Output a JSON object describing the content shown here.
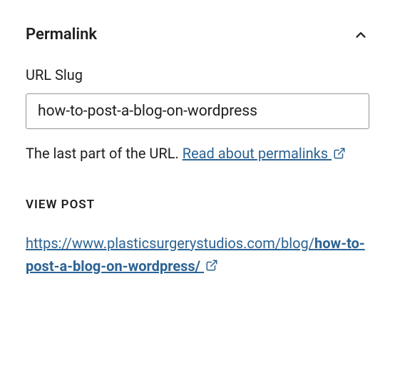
{
  "panel": {
    "title": "Permalink"
  },
  "slug": {
    "label": "URL Slug",
    "value": "how-to-post-a-blog-on-wordpress",
    "help_prefix": "The last part of the URL. ",
    "help_link": "Read about permalinks"
  },
  "view_post": {
    "heading": "VIEW POST",
    "url_base": "https://www.plasticsurgerystudios.com/blog/",
    "url_slug": "how-to-post-a-blog-on-wordpress/"
  }
}
